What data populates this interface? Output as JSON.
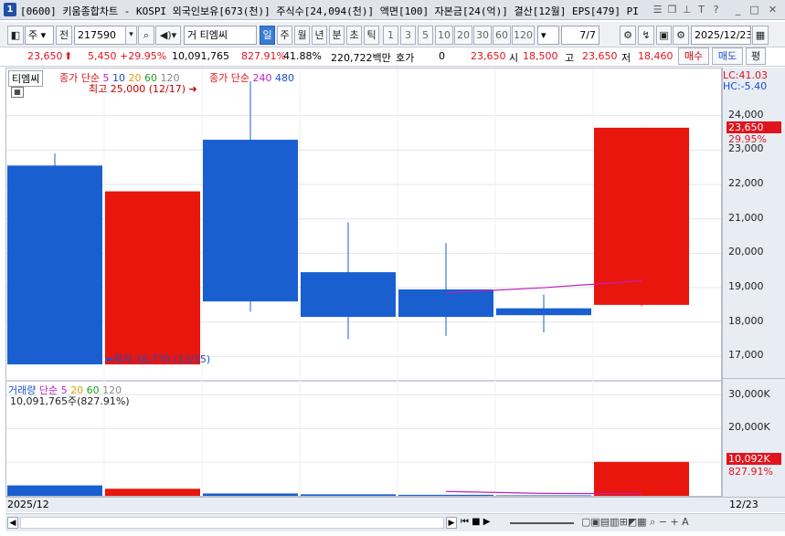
{
  "window": {
    "number": "1",
    "title": "[0600] 키움종합차트 - KOSPI 외국인보유[673(천)] 주식수[24,094(천)] 액면[100] 자본금[24(억)] 결산[12월] EPS[479] PI",
    "controls": [
      "list-icon",
      "restore-icon",
      "pin-icon",
      "text-T-icon",
      "help-icon",
      "minimize-icon",
      "maximize-icon",
      "close-icon"
    ]
  },
  "toolbar": {
    "mode": "주",
    "prev": "전",
    "code": "217590",
    "type_label": "거",
    "stock_name": "티엠씨",
    "periods": [
      "일",
      "주",
      "월",
      "년",
      "분",
      "초",
      "틱"
    ],
    "active_period": "일",
    "intervals": [
      "1",
      "3",
      "5",
      "10",
      "20",
      "30",
      "60",
      "120"
    ],
    "count": "7",
    "count_total": "/7",
    "date": "2025/12/23"
  },
  "price_row": {
    "price": "23,650",
    "change": "5,450",
    "change_pct": "+29.95%",
    "volume": "10,091,765",
    "vol_ratio": "827.91%",
    "turnover": "41.88%",
    "amount": "220,722백만",
    "bid_label": "호가",
    "bid_value": "0",
    "cur": "23,650",
    "open_label": "시",
    "open": "18,500",
    "high_label": "고",
    "high": "23,650",
    "low_label": "저",
    "low": "18,460",
    "buy": "매수",
    "sell": "매도",
    "eval": "평"
  },
  "price_panel": {
    "legend_name": "티엠씨",
    "legend_ma1_label": "종가 단순",
    "legend_ma1_periods": [
      "5",
      "10",
      "20",
      "60",
      "120"
    ],
    "legend_ma2_label": "종가 단순",
    "legend_ma2_periods": [
      "240",
      "480"
    ],
    "lc": "LC:41.03",
    "hc": "HC:-5.40",
    "max_note": "최고 25,000 (12/17)",
    "min_note": "최저 16,770 (12/15)",
    "last_price_tag": "23,650",
    "last_pct_tag": "29.95%",
    "y_ticks": [
      "24,000",
      "23,000",
      "22,000",
      "21,000",
      "20,000",
      "19,000",
      "18,000",
      "17,000"
    ]
  },
  "volume_panel": {
    "legend_name": "거래량",
    "legend_ma_label": "단순",
    "legend_ma_periods": [
      "5",
      "20",
      "60",
      "120"
    ],
    "max_note": "10,091,765주(827.91%)",
    "last_vol_tag": "10,092K",
    "last_pct_tag": "827.91%",
    "y_ticks": [
      "30,000K",
      "20,000K"
    ]
  },
  "footer": {
    "start_date": "2025/12",
    "end_date": "12/23"
  },
  "colors": {
    "up": "#e8160c",
    "down": "#1a5fd0",
    "ma5": "#c020c0",
    "accent": "#3a7bd5"
  },
  "chart_data": {
    "type": "candlestick",
    "candles": [
      {
        "open": 22550,
        "high": 22900,
        "low": 16770,
        "close": 16770
      },
      {
        "open": 16770,
        "high": 21800,
        "low": 16770,
        "close": 21800
      },
      {
        "open": 23300,
        "high": 25000,
        "low": 18300,
        "close": 18600
      },
      {
        "open": 19450,
        "high": 20900,
        "low": 17500,
        "close": 18150
      },
      {
        "open": 18950,
        "high": 20300,
        "low": 17600,
        "close": 18150
      },
      {
        "open": 18400,
        "high": 18800,
        "low": 17700,
        "close": 18200
      },
      {
        "open": 18500,
        "high": 23650,
        "low": 18460,
        "close": 23650
      }
    ],
    "ma5": [
      null,
      null,
      null,
      null,
      18850,
      19000,
      19200
    ],
    "volume": [
      3100000,
      2100000,
      700000,
      450000,
      300000,
      150000,
      10091765
    ],
    "volume_ma5": [
      null,
      null,
      null,
      null,
      1300000,
      720000,
      600000
    ],
    "ylim": [
      16400,
      25000
    ],
    "volume_ylim": [
      0,
      31500000
    ]
  }
}
